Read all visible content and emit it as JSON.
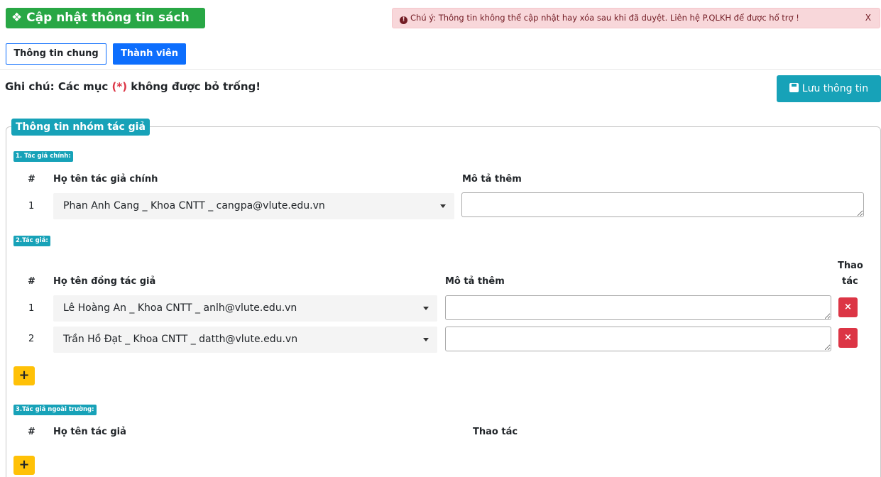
{
  "header": {
    "title": "❖ Cập nhật thông tin sách",
    "alert": "Chú ý: Thông tin không thể cập nhật hay xóa sau khi đã duyệt. Liên hệ P.QLKH để được hổ trợ !",
    "alert_close": "X"
  },
  "tabs": [
    {
      "label": "Thông tin chung"
    },
    {
      "label": "Thành viên"
    }
  ],
  "note": {
    "prefix": "Ghi chú: Các mục ",
    "required": "(*)",
    "suffix": " không được bỏ trống!"
  },
  "save_button": {
    "label": "Lưu thông tin"
  },
  "section": {
    "legend": "Thông tin nhóm tác giả",
    "main_author": {
      "label": "1. Tác giả chính:",
      "col_num": "#",
      "col_name": "Họ tên tác giả chính",
      "col_desc": "Mô tả thêm",
      "rows": [
        {
          "num": "1",
          "name": "Phan Anh Cang _ Khoa CNTT _ cangpa@vlute.edu.vn",
          "desc": ""
        }
      ]
    },
    "co_authors": {
      "label": "2.Tác giả:",
      "col_num": "#",
      "col_name": "Họ tên đồng tác giả",
      "col_desc": "Mô tả thêm",
      "col_action_1": "Thao",
      "col_action_2": "tác",
      "rows": [
        {
          "num": "1",
          "name": "Lê Hoàng An _ Khoa CNTT _ anlh@vlute.edu.vn",
          "desc": ""
        },
        {
          "num": "2",
          "name": "Trần Hồ Đạt _ Khoa CNTT _ datth@vlute.edu.vn",
          "desc": ""
        }
      ],
      "delete_label": "×",
      "add_label": "+"
    },
    "external_authors": {
      "label": "3.Tác giả ngoài trường:",
      "col_num": "#",
      "col_name": "Họ tên tác giả",
      "col_action": "Thao tác",
      "add_label": "+"
    }
  }
}
